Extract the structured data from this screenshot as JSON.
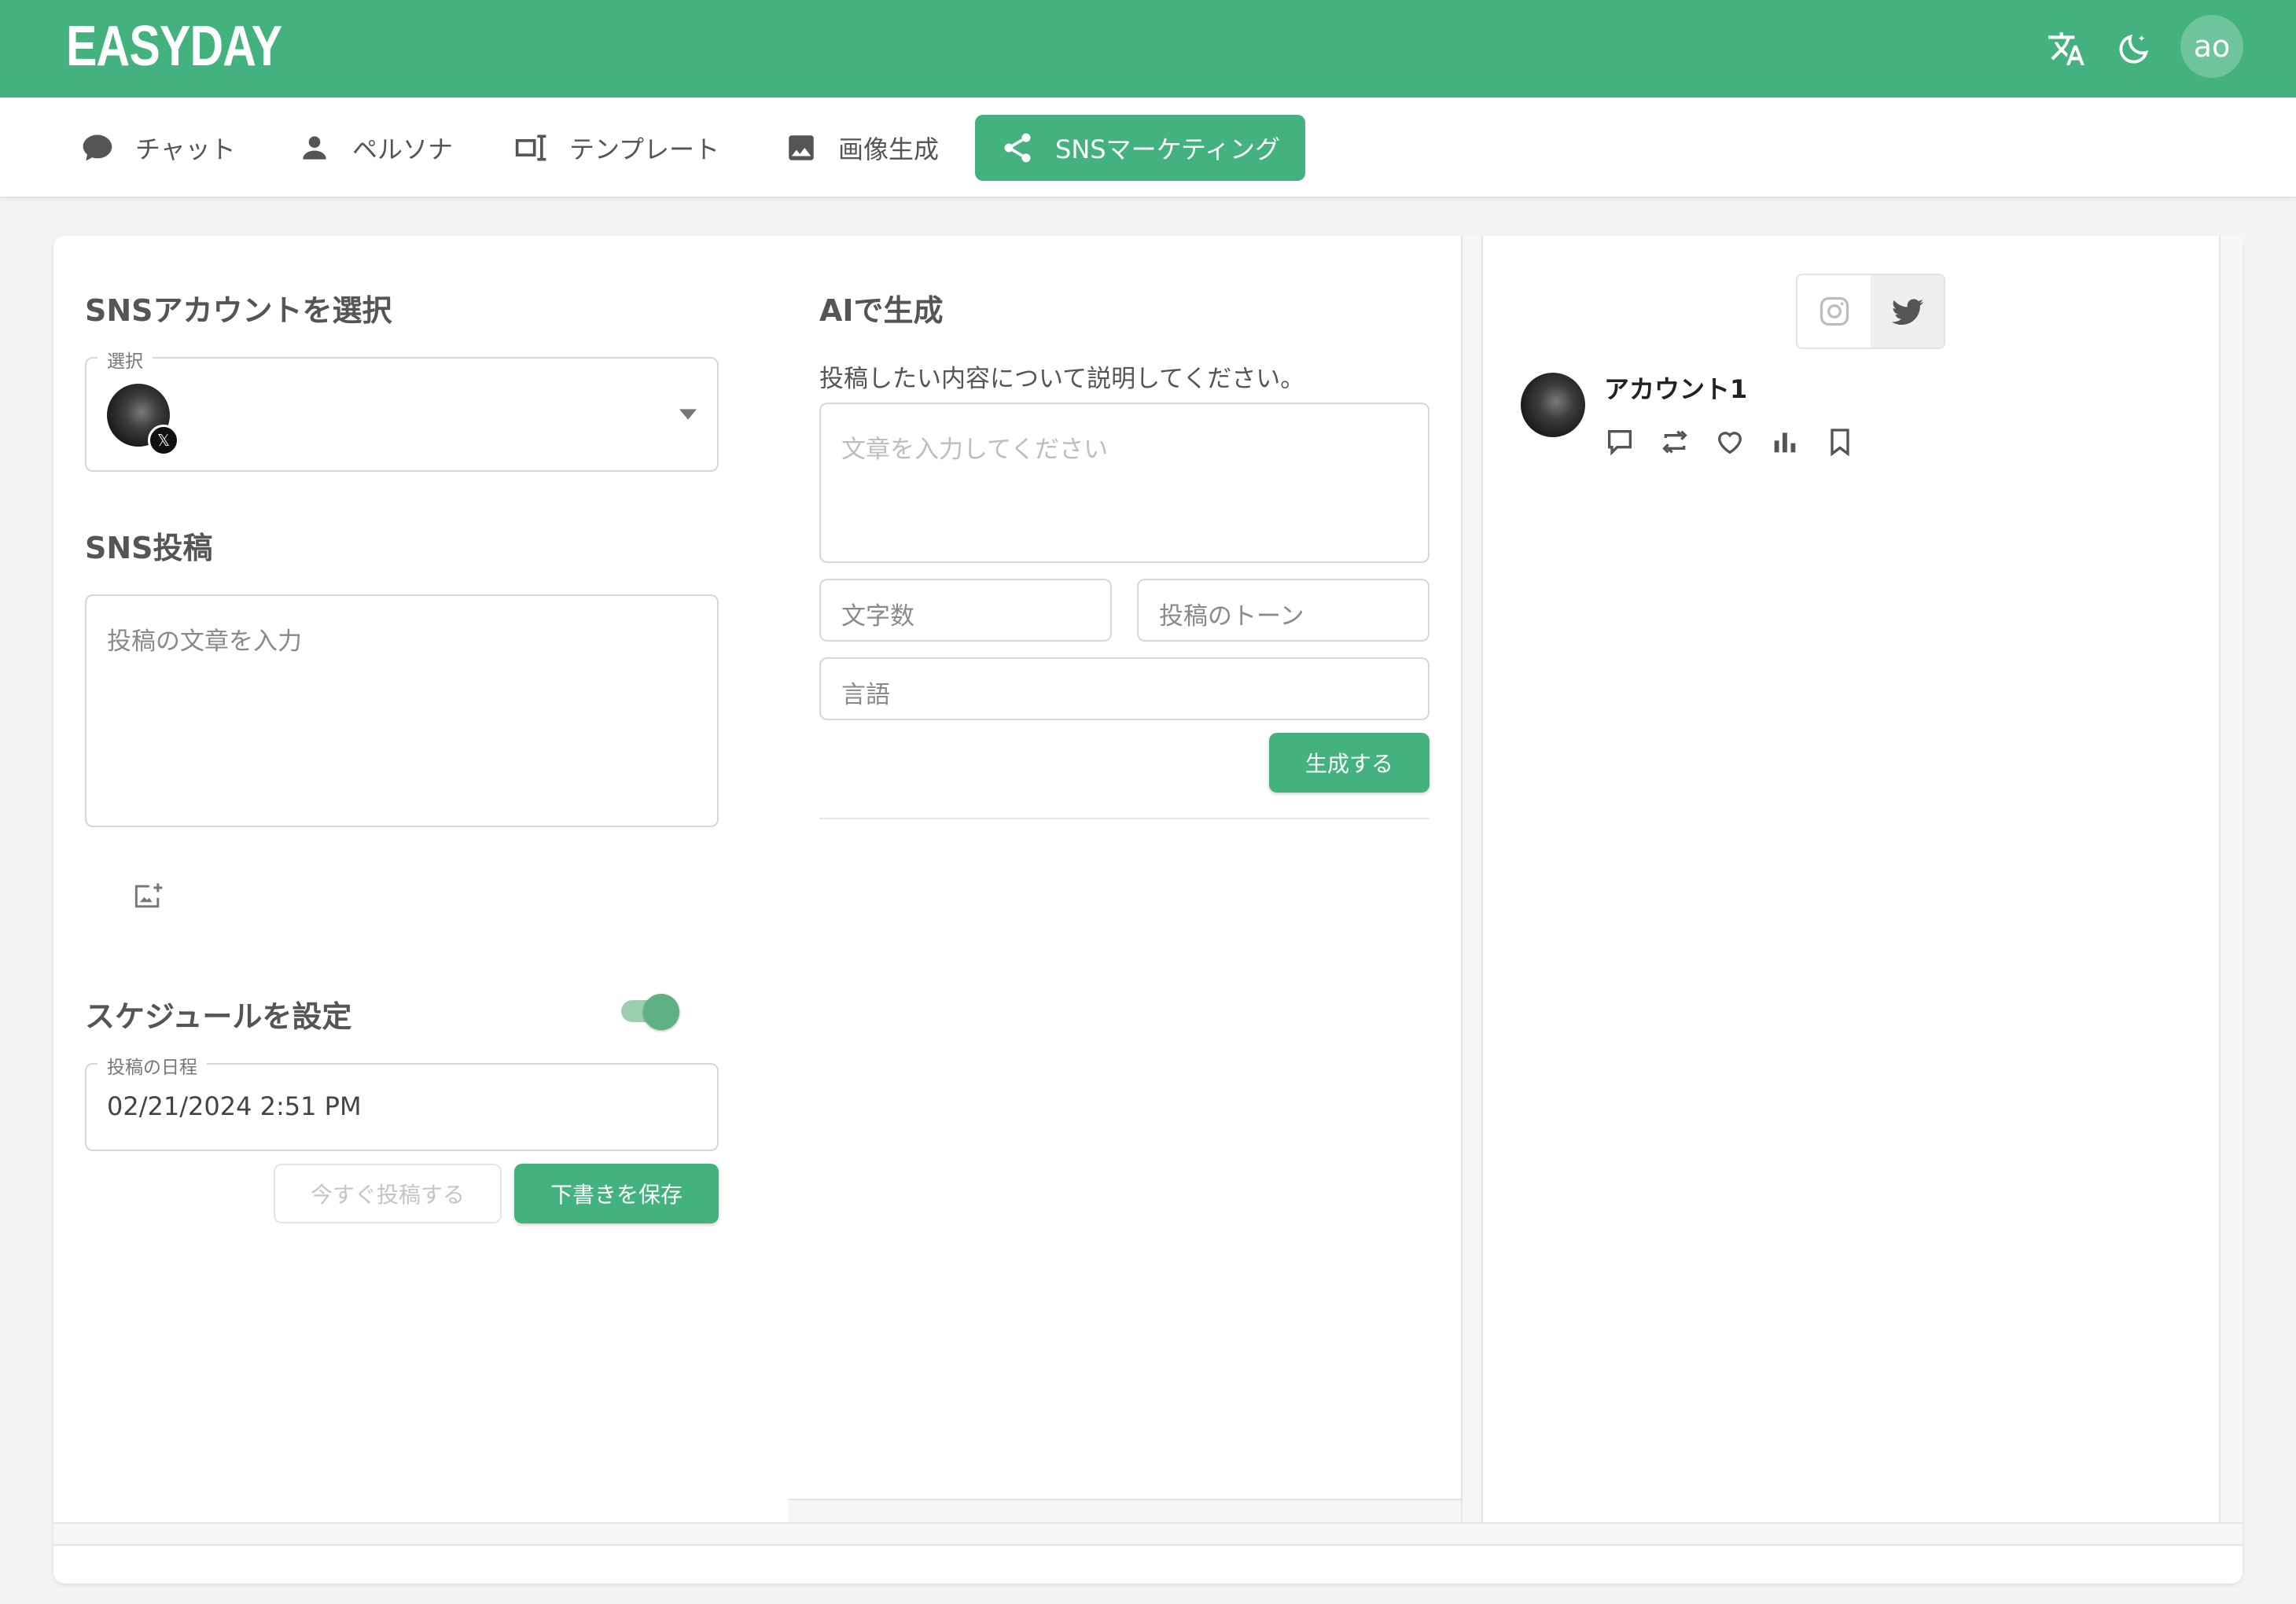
{
  "app": {
    "brand": "EASYDAY",
    "user_initials": "ao"
  },
  "nav": {
    "items": [
      {
        "label": "チャット",
        "icon": "chat-bubble-icon"
      },
      {
        "label": "ペルソナ",
        "icon": "person-icon"
      },
      {
        "label": "テンプレート",
        "icon": "template-icon"
      },
      {
        "label": "画像生成",
        "icon": "image-icon"
      },
      {
        "label": "SNSマーケティング",
        "icon": "share-icon",
        "active": true
      }
    ]
  },
  "left": {
    "account_section_title": "SNSアカウントを選択",
    "select_legend": "選択",
    "post_section_title": "SNS投稿",
    "post_placeholder": "投稿の文章を入力",
    "schedule_title": "スケジュールを設定",
    "schedule_enabled": true,
    "date_legend": "投稿の日程",
    "date_value": "02/21/2024 2:51 PM",
    "post_now_label": "今すぐ投稿する",
    "save_draft_label": "下書きを保存"
  },
  "ai": {
    "title": "AIで生成",
    "description": "投稿したい内容について説明してください。",
    "input_placeholder": "文章を入力してください",
    "char_count_placeholder": "文字数",
    "tone_placeholder": "投稿のトーン",
    "language_placeholder": "言語",
    "generate_label": "生成する"
  },
  "preview": {
    "tabs": [
      {
        "icon": "instagram-icon",
        "active": false
      },
      {
        "icon": "twitter-icon",
        "active": true
      }
    ],
    "account_name": "アカウント1",
    "actions": [
      "comment-icon",
      "retweet-icon",
      "heart-icon",
      "stats-icon",
      "bookmark-icon"
    ]
  },
  "colors": {
    "primary": "#44b27f",
    "text": "#555555",
    "border": "#d7d7d7"
  }
}
